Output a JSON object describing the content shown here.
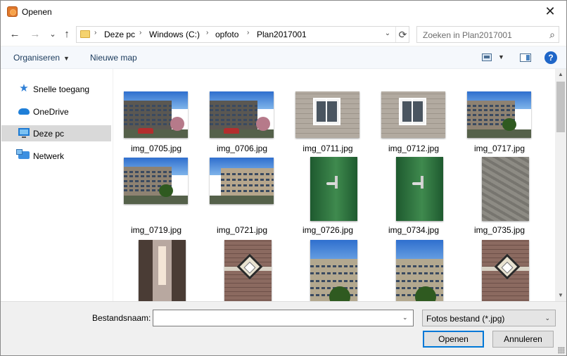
{
  "window": {
    "title": "Openen",
    "close_glyph": "✕"
  },
  "nav": {
    "back": "←",
    "forward": "→",
    "recent": "⌄",
    "up": "↑",
    "breadcrumb": [
      "Deze pc",
      "Windows (C:)",
      "opfoto",
      "Plan2017001"
    ],
    "crumb_sep": "›",
    "refresh_glyph": "⟳",
    "dropdown_glyph": "⌄",
    "search_placeholder": "Zoeken in Plan2017001",
    "search_glyph": "⌕"
  },
  "toolbar": {
    "organize": "Organiseren",
    "new_folder": "Nieuwe map",
    "caret": "▼",
    "help": "?"
  },
  "sidebar": {
    "items": [
      {
        "label": "Snelle toegang",
        "icon": "star-icon"
      },
      {
        "label": "OneDrive",
        "icon": "cloud-icon"
      },
      {
        "label": "Deze pc",
        "icon": "monitor-icon",
        "selected": true
      },
      {
        "label": "Netwerk",
        "icon": "network-icon"
      }
    ]
  },
  "files": [
    {
      "name": "img_0705.jpg",
      "kind": "building-wide"
    },
    {
      "name": "img_0706.jpg",
      "kind": "building-wide"
    },
    {
      "name": "img_0711.jpg",
      "kind": "window-wall"
    },
    {
      "name": "img_0712.jpg",
      "kind": "window-wall"
    },
    {
      "name": "img_0717.jpg",
      "kind": "building-side"
    },
    {
      "name": "img_0719.jpg",
      "kind": "building-side"
    },
    {
      "name": "img_0721.jpg",
      "kind": "building-corner"
    },
    {
      "name": "img_0726.jpg",
      "kind": "green-door"
    },
    {
      "name": "img_0734.jpg",
      "kind": "green-door"
    },
    {
      "name": "img_0735.jpg",
      "kind": "pavement"
    },
    {
      "name": "",
      "kind": "alley"
    },
    {
      "name": "",
      "kind": "brick-lamp"
    },
    {
      "name": "",
      "kind": "building-tall"
    },
    {
      "name": "",
      "kind": "building-tall"
    },
    {
      "name": "",
      "kind": "brick-lamp"
    }
  ],
  "scroll": {
    "up": "▲",
    "down": "▼"
  },
  "bottom": {
    "filename_label": "Bestandsnaam:",
    "filename_value": "",
    "filter": "Fotos bestand (*.jpg)",
    "dropdown_glyph": "⌄",
    "open": "Openen",
    "cancel": "Annuleren"
  }
}
